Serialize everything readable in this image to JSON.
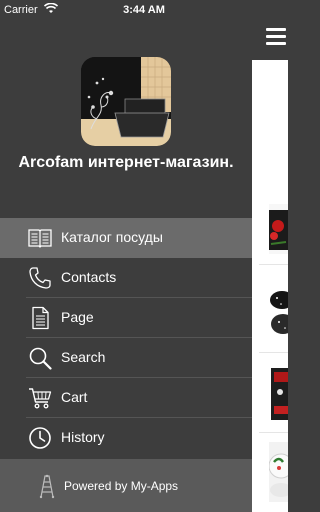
{
  "status_bar": {
    "carrier": "Carrier",
    "time": "3:44 AM"
  },
  "app": {
    "title": "Arcofam интернет-магазин."
  },
  "menu": {
    "items": [
      {
        "label": "Каталог посуды",
        "icon": "book-icon",
        "active": true
      },
      {
        "label": "Contacts",
        "icon": "phone-icon",
        "active": false
      },
      {
        "label": "Page",
        "icon": "document-icon",
        "active": false
      },
      {
        "label": "Search",
        "icon": "search-icon",
        "active": false
      },
      {
        "label": "Cart",
        "icon": "cart-icon",
        "active": false
      },
      {
        "label": "History",
        "icon": "clock-icon",
        "active": false
      }
    ]
  },
  "footer": {
    "powered_by": "Powered by My-Apps"
  },
  "colors": {
    "drawer_bg": "#3d3d3d",
    "active_item_bg": "#6b6b6b",
    "footer_bg": "#5a5a5a"
  }
}
